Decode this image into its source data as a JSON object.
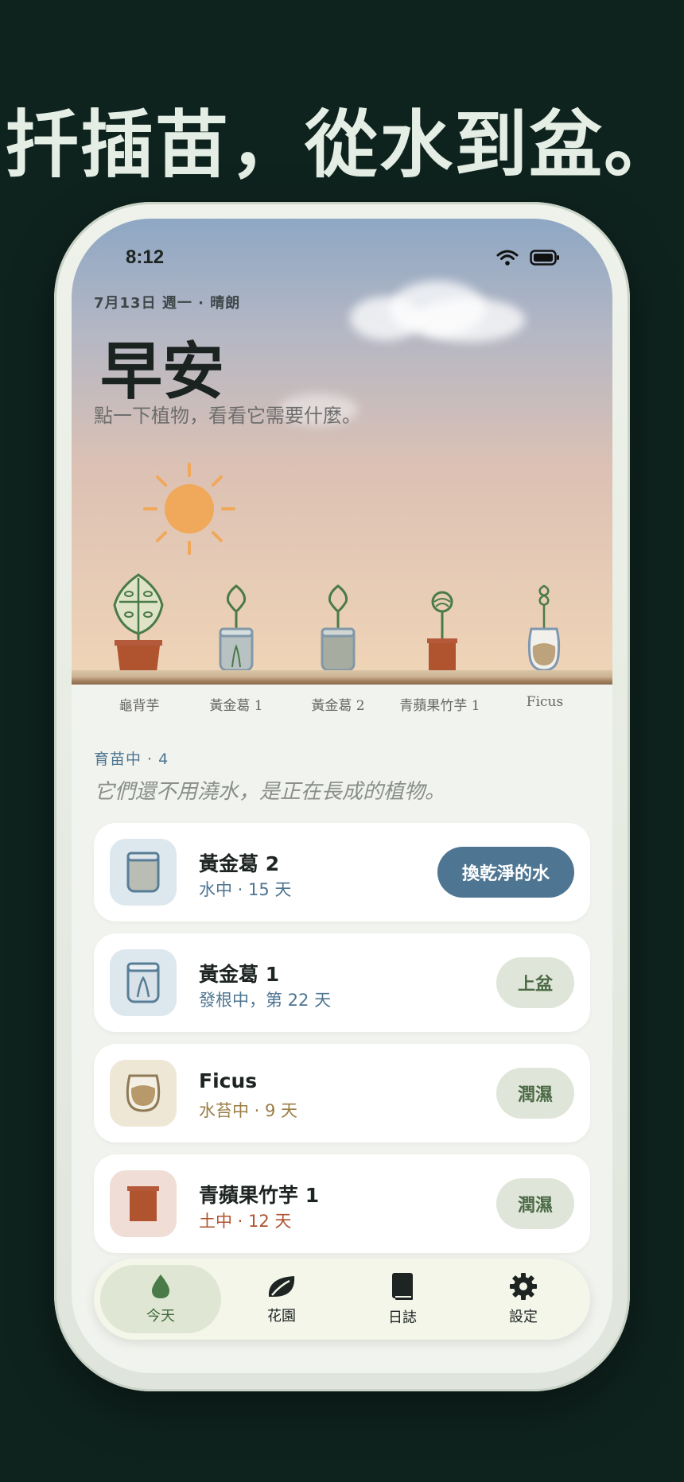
{
  "headline": "扦插苗，從水到盆。",
  "status": {
    "time": "8:12"
  },
  "header": {
    "date_line": "7月13日 週一 · 晴朗",
    "greeting": "早安",
    "subtitle": "點一下植物，看看它需要什麼。"
  },
  "shelf": {
    "plants": [
      {
        "name": "龜背芋",
        "icon": "monstera-pot-icon"
      },
      {
        "name": "黃金葛 1",
        "icon": "pothos-water-jar-icon"
      },
      {
        "name": "黃金葛 2",
        "icon": "pothos-water-jar-icon"
      },
      {
        "name": "青蘋果竹芋 1",
        "icon": "calathea-soil-pot-icon"
      },
      {
        "name": "Ficus",
        "icon": "ficus-moss-jar-icon"
      }
    ]
  },
  "section": {
    "label": "育苗中 · 4",
    "note": "它們還不用澆水，是正在長成的植物。"
  },
  "cards": [
    {
      "title": "黃金葛 2",
      "meta": "水中 · 15 天",
      "action": "換乾淨的水",
      "meta_color": "#4e7591",
      "icon": "water-jar-icon"
    },
    {
      "title": "黃金葛 1",
      "meta": "發根中，第 22 天",
      "action": "上盆",
      "meta_color": "#4e7591",
      "icon": "rooting-jar-icon"
    },
    {
      "title": "Ficus",
      "meta": "水苔中 · 9 天",
      "action": "潤濕",
      "meta_color": "#9a7d45",
      "icon": "moss-jar-icon"
    },
    {
      "title": "青蘋果竹芋 1",
      "meta": "土中 · 12 天",
      "action": "潤濕",
      "meta_color": "#b0532f",
      "icon": "soil-pot-icon"
    }
  ],
  "tabs": [
    {
      "label": "今天",
      "icon": "drop-icon",
      "active": true
    },
    {
      "label": "花園",
      "icon": "leaf-icon",
      "active": false
    },
    {
      "label": "日誌",
      "icon": "book-icon",
      "active": false
    },
    {
      "label": "設定",
      "icon": "gear-icon",
      "active": false
    }
  ],
  "colors": {
    "background": "#0f231e",
    "primary_action": "#4e7591",
    "secondary_action": "#dfe6d9",
    "accent_green": "#3d6a3b",
    "terracotta": "#b0532f"
  }
}
